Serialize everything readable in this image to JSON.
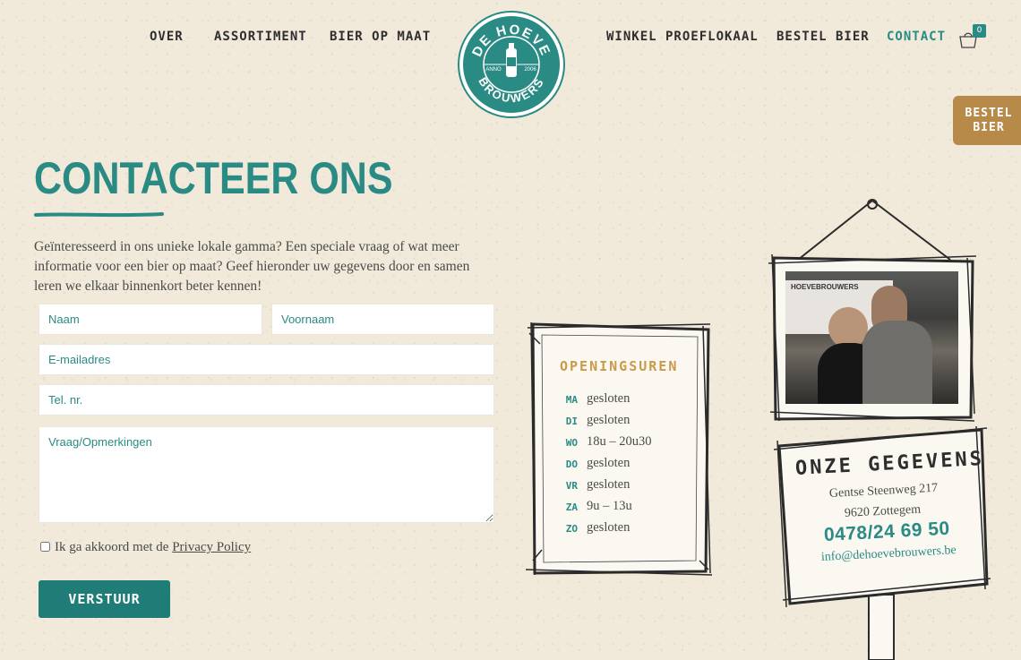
{
  "nav": {
    "left": [
      "OVER",
      "ASSORTIMENT",
      "BIER OP MAAT"
    ],
    "right": [
      "WINKEL PROEFLOKAAL",
      "BESTEL BIER",
      "CONTACT"
    ],
    "active": "CONTACT",
    "cart_count": "0"
  },
  "logo": {
    "top": "DE HOEVE",
    "bottom": "BROUWERS",
    "left": "ANNO",
    "right": "2006"
  },
  "side_cta": {
    "line1": "BESTEL",
    "line2": "BIER"
  },
  "page": {
    "title": "CONTACTEER ONS",
    "intro": "Geïnteresseerd in ons unieke lokale gamma? Een speciale vraag of wat meer informatie voor een bier op maat? Geef hieronder uw gegevens door en samen leren we elkaar binnenkort beter kennen!"
  },
  "form": {
    "naam": "Naam",
    "voornaam": "Voornaam",
    "email": "E-mailadres",
    "tel": "Tel. nr.",
    "vraag": "Vraag/Opmerkingen",
    "consent_prefix": "Ik ga akkoord met de ",
    "consent_link": "Privacy Policy",
    "submit": "VERSTUUR"
  },
  "hours": {
    "title": "OPENINGSUREN",
    "rows": [
      {
        "day": "MA",
        "value": "gesloten"
      },
      {
        "day": "DI",
        "value": "gesloten"
      },
      {
        "day": "WO",
        "value": "18u – 20u30"
      },
      {
        "day": "DO",
        "value": "gesloten"
      },
      {
        "day": "VR",
        "value": "gesloten"
      },
      {
        "day": "ZA",
        "value": "9u – 13u"
      },
      {
        "day": "ZO",
        "value": "gesloten"
      }
    ]
  },
  "contact": {
    "title": "ONZE GEGEVENS",
    "street": "Gentse Steenweg 217",
    "city": "9620 Zottegem",
    "phone": "0478/24 69 50",
    "email": "info@dehoevebrouwers.be"
  },
  "photo": {
    "banner": "HOEVEBROUWERS"
  },
  "colors": {
    "teal": "#2a8a84",
    "gold": "#c99a4a",
    "cta_brown": "#b88a4a",
    "background": "#f1eadb"
  }
}
